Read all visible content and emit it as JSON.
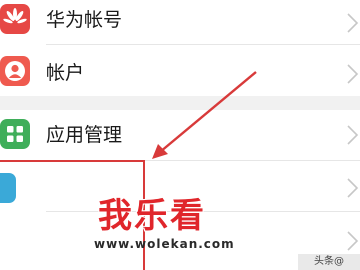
{
  "settings_list": {
    "items": [
      {
        "label": "华为帐号",
        "icon": "huawei-logo-icon",
        "icon_color": "#e64845"
      },
      {
        "label": "帐户",
        "icon": "user-account-icon",
        "icon_color": "#ef5a4f"
      },
      {
        "label": "应用管理",
        "icon": "app-grid-icon",
        "icon_color": "#3fae5a"
      },
      {
        "label": "",
        "icon": "blue-app-icon",
        "icon_color": "#3aa9d8"
      }
    ]
  },
  "watermark": {
    "brand": "我乐看",
    "url": "www.wolekan.com",
    "corner_text": "头条@"
  },
  "colors": {
    "annotation_red": "#d83a3a",
    "watermark_red": "#e0262b",
    "group_gap": "#f1f1f1"
  }
}
